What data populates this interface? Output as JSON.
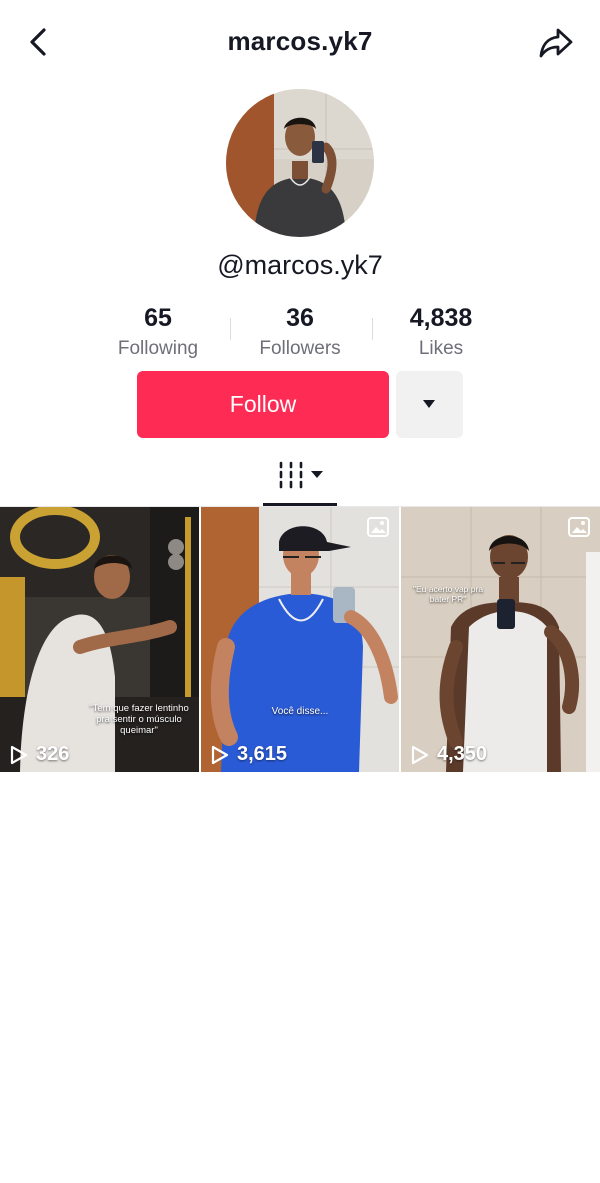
{
  "header": {
    "title": "marcos.yk7"
  },
  "profile": {
    "handle": "@marcos.yk7",
    "stats": [
      {
        "value": "65",
        "label": "Following"
      },
      {
        "value": "36",
        "label": "Followers"
      },
      {
        "value": "4,838",
        "label": "Likes"
      }
    ],
    "follow_label": "Follow"
  },
  "colors": {
    "accent": "#fe2c55",
    "secondary_button": "#f1f1f2",
    "text": "#161823",
    "muted": "#6f7077"
  },
  "icons": {
    "back": "chevron-left-icon",
    "share": "share-arrow-icon",
    "more": "caret-down-icon",
    "videos_tab": "grid-columns-icon",
    "play": "play-outline-icon",
    "photo": "photo-badge-icon"
  },
  "videos": [
    {
      "views": "326",
      "caption": "\"Tem que fazer lentinho pra sentir o músculo queimar\"",
      "photo_badge": false
    },
    {
      "views": "3,615",
      "caption": "Você disse...",
      "photo_badge": true
    },
    {
      "views": "4,350",
      "caption": "\"Eu acerto vap pra bater PR\"",
      "photo_badge": true
    }
  ]
}
